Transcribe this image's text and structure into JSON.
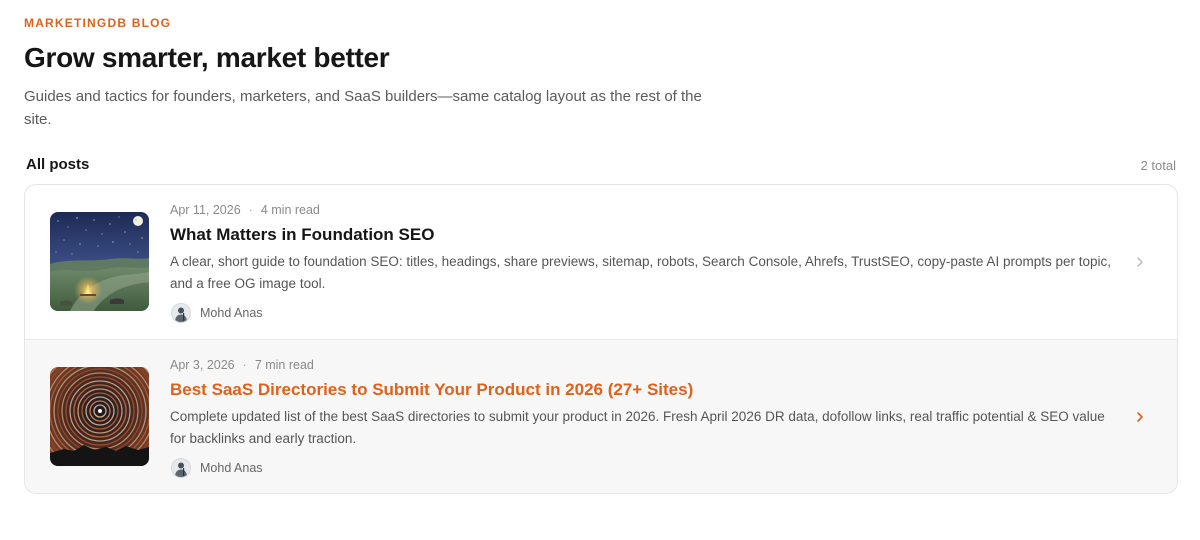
{
  "blog": {
    "eyebrow": "MARKETINGDB BLOG",
    "title": "Grow smarter, market better",
    "subtitle": "Guides and tactics for founders, marketers, and SaaS builders—same catalog layout as the rest of the site."
  },
  "section": {
    "title": "All posts",
    "count": "2 total"
  },
  "colors": {
    "accent": "#e0621a",
    "text": "#161616",
    "muted": "#8a8a8a"
  },
  "posts": [
    {
      "date": "Apr 11, 2026",
      "separator": "·",
      "read_time": "4 min read",
      "title": "What Matters in Foundation SEO",
      "excerpt": "A clear, short guide to foundation SEO: titles, headings, share previews, sitemap, robots, Search Console, Ahrefs, TrustSEO, copy-paste AI prompts per topic, and a free OG image tool.",
      "author": "Mohd Anas",
      "thumbnail_icon": "night-landscape-campfire-image",
      "arrow_icon": "chevron-right-icon"
    },
    {
      "date": "Apr 3, 2026",
      "separator": "·",
      "read_time": "7 min read",
      "title": "Best SaaS Directories to Submit Your Product in 2026 (27+ Sites)",
      "excerpt": "Complete updated list of the best SaaS directories to submit your product in 2026. Fresh April 2026 DR data, dofollow links, real traffic potential & SEO value for backlinks and early traction.",
      "author": "Mohd Anas",
      "thumbnail_icon": "star-trails-image",
      "arrow_icon": "chevron-right-icon"
    }
  ]
}
